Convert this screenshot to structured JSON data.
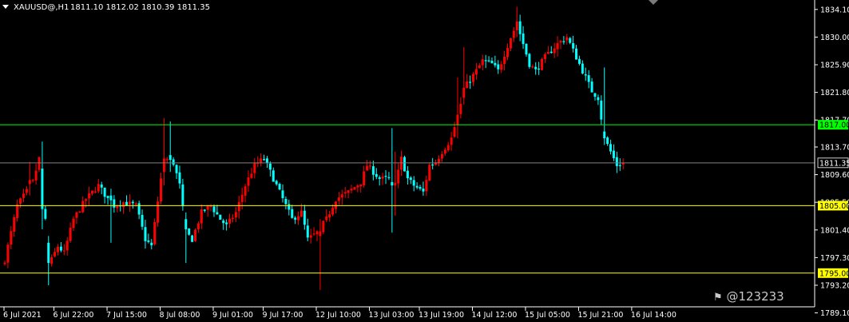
{
  "header": {
    "symbol_text": "XAUUSD@,H1",
    "ohlc_text": "1811.10 1812.02 1810.39 1811.35"
  },
  "watermark": {
    "text": "@123233"
  },
  "colors": {
    "bull": "#ff0000",
    "bear": "#00ffff",
    "background": "#000000",
    "green_line": "#00ff00",
    "yellow_line": "#ffff00",
    "current_line": "#808080",
    "axis": "#ffffff"
  },
  "chart_data": {
    "type": "candlestick",
    "symbol": "XAUUSD@",
    "timeframe": "H1",
    "ylim": [
      1790.0,
      1835.5
    ],
    "y_ticks": [
      "1834.10",
      "1830.00",
      "1825.90",
      "1821.80",
      "1817.70",
      "1813.70",
      "1809.60",
      "1805.50",
      "1801.40",
      "1797.30",
      "1793.20",
      "1789.10"
    ],
    "x_labels": [
      "6 Jul 2021",
      "6 Jul 22:00",
      "7 Jul 15:00",
      "8 Jul 08:00",
      "9 Jul 01:00",
      "9 Jul 17:00",
      "12 Jul 10:00",
      "13 Jul 03:00",
      "13 Jul 19:00",
      "14 Jul 12:00",
      "15 Jul 05:00",
      "15 Jul 21:00",
      "16 Jul 14:00"
    ],
    "x_label_bar_index": [
      0,
      16,
      33,
      50,
      67,
      83,
      100,
      117,
      133,
      150,
      167,
      184,
      201
    ],
    "horizontal_levels": [
      {
        "price": 1817.0,
        "label": "1817.00",
        "color": "#00ff00"
      },
      {
        "price": 1805.0,
        "label": "1805.00",
        "color": "#ffff00"
      },
      {
        "price": 1795.0,
        "label": "1795.00",
        "color": "#ffff00"
      }
    ],
    "current_price": {
      "price": 1811.35,
      "label": "1811.35"
    },
    "bar_count": 212,
    "close_path": [
      [
        0,
        1797
      ],
      [
        4,
        1805
      ],
      [
        9,
        1808.5
      ],
      [
        11,
        1812
      ],
      [
        13,
        1803
      ],
      [
        15,
        1797
      ],
      [
        17,
        1799
      ],
      [
        19,
        1798
      ],
      [
        22,
        1803
      ],
      [
        26,
        1806
      ],
      [
        30,
        1808
      ],
      [
        33,
        1806
      ],
      [
        35,
        1805
      ],
      [
        38,
        1805.5
      ],
      [
        42,
        1805
      ],
      [
        45,
        1800
      ],
      [
        47,
        1799
      ],
      [
        50,
        1809
      ],
      [
        53,
        1813
      ],
      [
        56,
        1808
      ],
      [
        58,
        1801
      ],
      [
        60,
        1800
      ],
      [
        63,
        1804
      ],
      [
        66,
        1805
      ],
      [
        69,
        1803
      ],
      [
        71,
        1802
      ],
      [
        74,
        1804
      ],
      [
        77,
        1808
      ],
      [
        80,
        1811
      ],
      [
        83,
        1812
      ],
      [
        86,
        1809
      ],
      [
        89,
        1806
      ],
      [
        92,
        1803
      ],
      [
        95,
        1804
      ],
      [
        97,
        1800
      ],
      [
        100,
        1801
      ],
      [
        103,
        1803
      ],
      [
        106,
        1806
      ],
      [
        110,
        1807
      ],
      [
        114,
        1808.5
      ],
      [
        116,
        1811
      ],
      [
        118,
        1810
      ],
      [
        120,
        1809
      ],
      [
        123,
        1809
      ],
      [
        125,
        1808
      ],
      [
        127,
        1812
      ],
      [
        129,
        1809
      ],
      [
        131,
        1808
      ],
      [
        134,
        1807
      ],
      [
        136,
        1811
      ],
      [
        138,
        1811.5
      ],
      [
        140,
        1813
      ],
      [
        143,
        1815
      ],
      [
        146,
        1820
      ],
      [
        148,
        1823
      ],
      [
        151,
        1825
      ],
      [
        153,
        1826.5
      ],
      [
        156,
        1826
      ],
      [
        158,
        1825
      ],
      [
        162,
        1830
      ],
      [
        164,
        1832
      ],
      [
        166,
        1829
      ],
      [
        168,
        1826
      ],
      [
        170,
        1825
      ],
      [
        173,
        1827
      ],
      [
        177,
        1829
      ],
      [
        180,
        1830
      ],
      [
        182,
        1828
      ],
      [
        184,
        1826
      ],
      [
        186,
        1824
      ],
      [
        188,
        1822
      ],
      [
        190,
        1821
      ],
      [
        192,
        1815
      ],
      [
        194,
        1813
      ],
      [
        196,
        1811
      ],
      [
        198,
        1811.35
      ]
    ],
    "special_bars": [
      {
        "i": 8,
        "o": 1808.2,
        "c": 1808.8,
        "h": 1811.5,
        "l": 1806.5
      },
      {
        "i": 12,
        "o": 1810.5,
        "c": 1804.5,
        "h": 1814.5,
        "l": 1801.5
      },
      {
        "i": 14,
        "o": 1799.5,
        "c": 1796.5,
        "h": 1800.5,
        "l": 1793.2
      },
      {
        "i": 34,
        "o": 1806.5,
        "c": 1805.8,
        "h": 1807.5,
        "l": 1799.5
      },
      {
        "i": 51,
        "o": 1810,
        "c": 1812,
        "h": 1818,
        "l": 1808
      },
      {
        "i": 53,
        "o": 1812.5,
        "c": 1811.8,
        "h": 1817.5,
        "l": 1810
      },
      {
        "i": 58,
        "o": 1803,
        "c": 1801.5,
        "h": 1804,
        "l": 1796.5
      },
      {
        "i": 101,
        "o": 1800.5,
        "c": 1801.2,
        "h": 1803,
        "l": 1792.5
      },
      {
        "i": 124,
        "o": 1808.5,
        "c": 1808,
        "h": 1816.5,
        "l": 1801
      },
      {
        "i": 125,
        "o": 1808,
        "c": 1808.4,
        "h": 1813,
        "l": 1803.5
      },
      {
        "i": 145,
        "o": 1817,
        "c": 1818.5,
        "h": 1824,
        "l": 1815
      },
      {
        "i": 147,
        "o": 1821,
        "c": 1822.5,
        "h": 1828.5,
        "l": 1820
      },
      {
        "i": 164,
        "o": 1831,
        "c": 1832.3,
        "h": 1834.5,
        "l": 1830
      },
      {
        "i": 192,
        "o": 1816,
        "c": 1815,
        "h": 1825.5,
        "l": 1814
      }
    ]
  }
}
